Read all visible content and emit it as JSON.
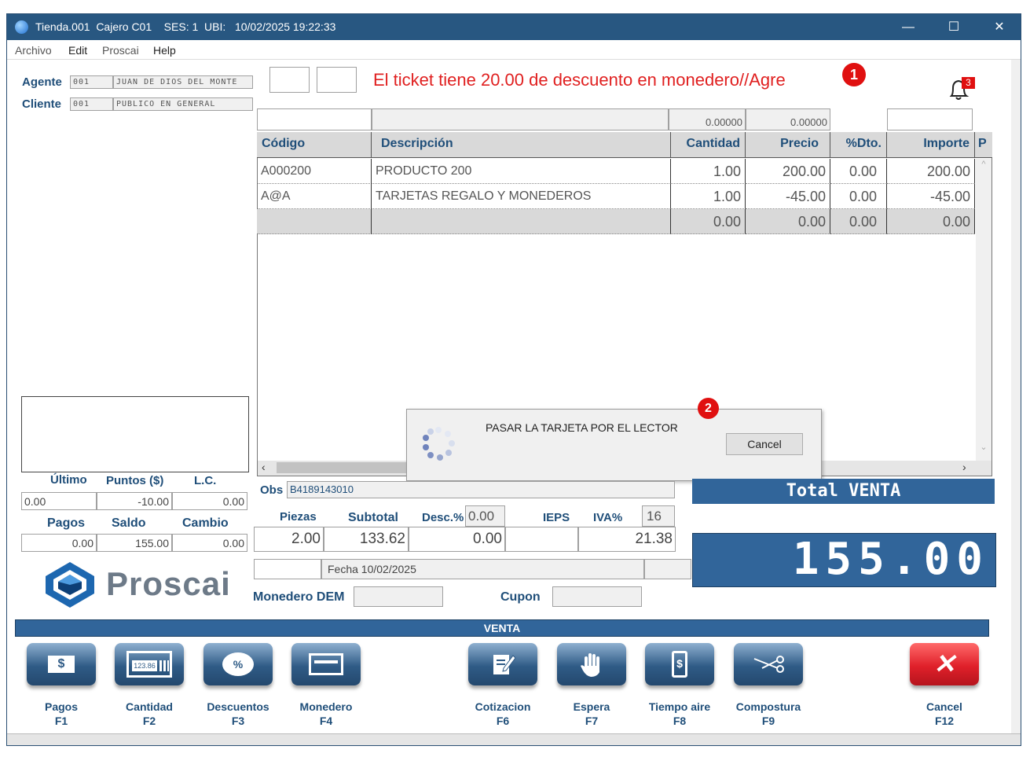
{
  "window": {
    "title": "Tienda.001  Cajero C01    SES: 1  UBI:   10/02/2025 19:22:33"
  },
  "menu": [
    "Archivo",
    "Edit",
    "Proscai",
    "Help"
  ],
  "agent": {
    "label": "Agente",
    "code": "001",
    "name": "JUAN DE DIOS DEL MONTE"
  },
  "client": {
    "label": "Cliente",
    "code": "001",
    "name": "PUBLICO EN GENERAL"
  },
  "message": "El ticket tiene 20.00 de descuento en monedero//Agre",
  "badges": {
    "step1": "1",
    "step2": "2",
    "notifications": "3"
  },
  "top_fields": {
    "a": "0.00000",
    "b": "0.00000"
  },
  "table": {
    "columns": [
      "Código",
      "Descripción",
      "Cantidad",
      "Precio",
      "%Dto.",
      "Importe",
      "P"
    ],
    "rows": [
      [
        "A000200",
        "PRODUCTO 200",
        "1.00",
        "200.00",
        "0.00",
        "200.00"
      ],
      [
        "A@A",
        "TARJETAS REGALO Y MONEDEROS",
        "1.00",
        "-45.00",
        "0.00",
        "-45.00"
      ],
      [
        "",
        "",
        "0.00",
        "0.00",
        "0.00",
        "0.00"
      ]
    ]
  },
  "dialog": {
    "message": "PASAR LA TARJETA POR EL LECTOR",
    "cancel": "Cancel"
  },
  "points": {
    "labels": [
      "Último",
      "Puntos ($)",
      "L.C."
    ],
    "values": [
      "0.00",
      "-10.00",
      "0.00"
    ]
  },
  "payments": {
    "labels": [
      "Pagos",
      "Saldo",
      "Cambio"
    ],
    "values": [
      "0.00",
      "155.00",
      "0.00"
    ]
  },
  "logo": "Proscai",
  "obs": {
    "label": "Obs",
    "value": "B4189143010"
  },
  "totals": {
    "labels": {
      "piezas": "Piezas",
      "subtotal": "Subtotal",
      "desc": "Desc.%",
      "ieps": "IEPS",
      "iva": "IVA%"
    },
    "desc_pct": "0.00",
    "iva_pct": "16",
    "piezas": "2.00",
    "subtotal": "133.62",
    "desc": "0.00",
    "iva": "21.38"
  },
  "fecha": "Fecha 10/02/2025",
  "monedero": {
    "label": "Monedero DEM"
  },
  "cupon": {
    "label": "Cupon"
  },
  "total": {
    "label": "Total VENTA",
    "value": "155.00"
  },
  "section_label": "VENTA",
  "buttons": [
    {
      "label": "Pagos",
      "key": "F1",
      "icon": "cash-icon"
    },
    {
      "label": "Cantidad",
      "key": "F2",
      "icon": "calculator-icon"
    },
    {
      "label": "Descuentos",
      "key": "F3",
      "icon": "percent-badge-icon"
    },
    {
      "label": "Monedero",
      "key": "F4",
      "icon": "card-icon"
    },
    {
      "label": "Cotizacion",
      "key": "F6",
      "icon": "edit-document-icon"
    },
    {
      "label": "Espera",
      "key": "F7",
      "icon": "hand-icon"
    },
    {
      "label": "Tiempo aire",
      "key": "F8",
      "icon": "phone-dollar-icon"
    },
    {
      "label": "Compostura",
      "key": "F9",
      "icon": "scissors-icon"
    },
    {
      "label": "Cancel",
      "key": "F12",
      "icon": "close-x-icon"
    }
  ],
  "colors": {
    "titlebar": "#285781",
    "accent": "#1f4e79",
    "message": "#e02020",
    "total_bg": "#31659a",
    "cancel": "#e0202a"
  }
}
